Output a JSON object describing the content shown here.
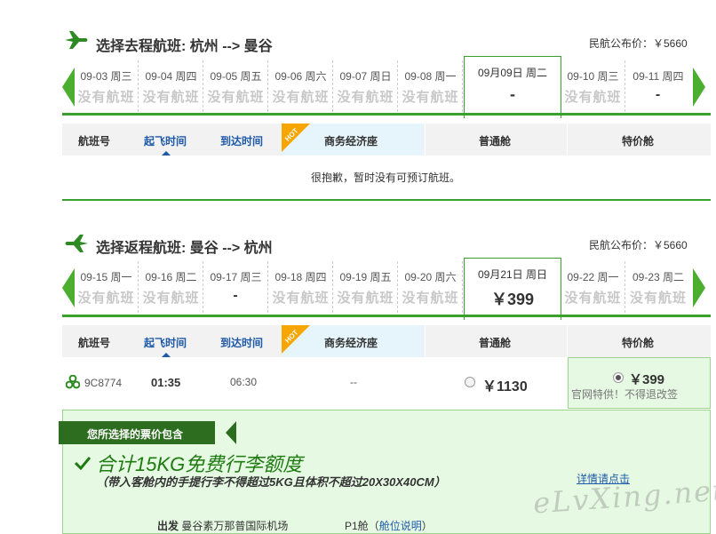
{
  "outbound": {
    "title": "选择去程航班: 杭州 --> 曼谷",
    "public_price": "民航公布价：￥5660",
    "dates": [
      {
        "date": "09-03 周三",
        "value": "没有航班",
        "dash": false
      },
      {
        "date": "09-04 周四",
        "value": "没有航班",
        "dash": false
      },
      {
        "date": "09-05 周五",
        "value": "没有航班",
        "dash": false
      },
      {
        "date": "09-06 周六",
        "value": "没有航班",
        "dash": false
      },
      {
        "date": "09-07 周日",
        "value": "没有航班",
        "dash": false
      },
      {
        "date": "09-08 周一",
        "value": "没有航班",
        "dash": false
      }
    ],
    "selected": {
      "date": "09月09日 周二",
      "value": "-"
    },
    "after": [
      {
        "date": "09-10 周三",
        "value": "没有航班",
        "dash": false
      },
      {
        "date": "09-11 周四",
        "value": "-",
        "dash": true
      }
    ],
    "no_flight_msg": "很抱歉，暂时没有可预订航班。"
  },
  "inbound": {
    "title": "选择返程航班: 曼谷 --> 杭州",
    "public_price": "民航公布价：￥5660",
    "dates": [
      {
        "date": "09-15 周一",
        "value": "没有航班",
        "dash": false
      },
      {
        "date": "09-16 周二",
        "value": "没有航班",
        "dash": false
      },
      {
        "date": "09-17 周三",
        "value": "-",
        "dash": true
      },
      {
        "date": "09-18 周四",
        "value": "没有航班",
        "dash": false
      },
      {
        "date": "09-19 周五",
        "value": "没有航班",
        "dash": false
      },
      {
        "date": "09-20 周六",
        "value": "没有航班",
        "dash": false
      }
    ],
    "selected": {
      "date": "09月21日 周日",
      "value": "￥399"
    },
    "after": [
      {
        "date": "09-22 周一",
        "value": "没有航班",
        "dash": false
      },
      {
        "date": "09-23 周二",
        "value": "没有航班",
        "dash": false
      }
    ],
    "flight": {
      "number": "9C8774",
      "depart": "01:35",
      "arrive": "06:30",
      "business": "--",
      "economy_price": "￥1130",
      "special_price": "￥399",
      "special_note": "官网特供！不得退改签"
    }
  },
  "table_headers": {
    "flight_no": "航班号",
    "depart_time": "起飞时间",
    "arrive_time": "到达时间",
    "hot": "HOT",
    "business": "商务经济座",
    "economy": "普通舱",
    "special": "特价舱"
  },
  "package": {
    "banner": "您所选择的票价包含",
    "headline": "合计15KG免费行李额度",
    "subline": "（带入客舱内的手提行李不得超过5KG且体积不超过20X30X40CM）",
    "detail_link": "详情请点击",
    "bottom_label": "出发",
    "bottom_airport": "曼谷素万那普国际机场",
    "bottom_cabin": "P1舱（",
    "bottom_cabin_link": "舱位说明",
    "bottom_cabin_close": "）"
  },
  "watermark": "eLvXing.net",
  "colors": {
    "green": "#3aa02c",
    "dark_green": "#2c6d1f",
    "blue": "#1e5aa8",
    "orange": "#f7a600"
  }
}
